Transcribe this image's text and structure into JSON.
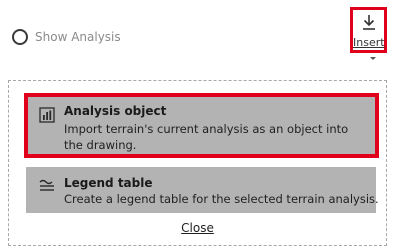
{
  "toolbar": {
    "show_analysis_label": "Show Analysis",
    "insert_label": "Insert"
  },
  "menu": {
    "items": [
      {
        "title": "Analysis object",
        "description": "Import terrain's current analysis as an object into the drawing.",
        "icon": "chart-icon",
        "highlighted": true
      },
      {
        "title": "Legend table",
        "description": "Create a legend table for the selected terrain analysis.",
        "icon": "legend-lines-icon",
        "highlighted": false
      }
    ],
    "close_label": "Close"
  },
  "colors": {
    "highlight_border": "#e0001b",
    "item_background": "#b3b3b3"
  }
}
